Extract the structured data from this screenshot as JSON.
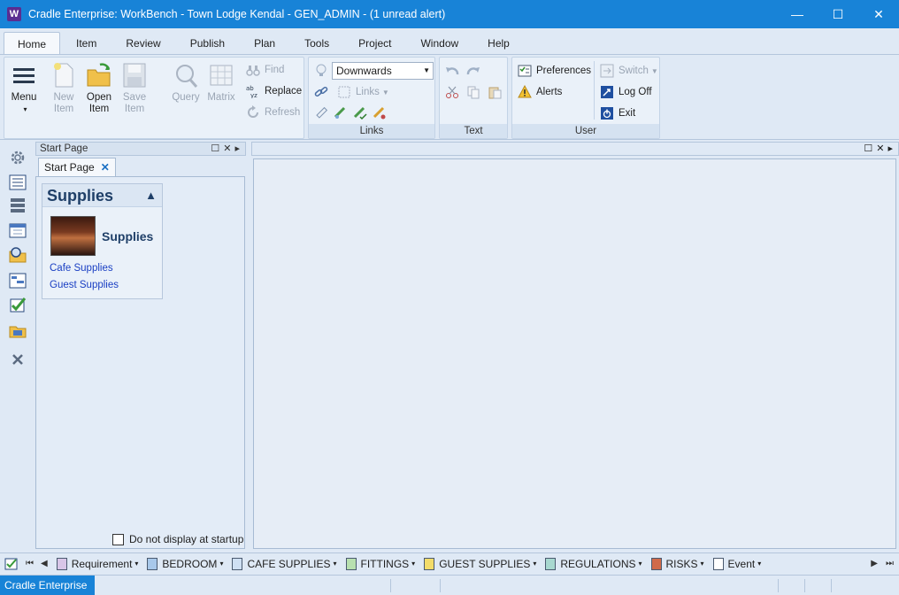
{
  "window": {
    "app_icon_letter": "W",
    "title": "Cradle Enterprise: WorkBench - Town Lodge Kendal - GEN_ADMIN - (1 unread alert)",
    "minimize": "—",
    "maximize": "☐",
    "close": "✕"
  },
  "ribbon_tabs": [
    "Home",
    "Item",
    "Review",
    "Publish",
    "Plan",
    "Tools",
    "Project",
    "Window",
    "Help"
  ],
  "ribbon": {
    "menu": {
      "label": "Menu",
      "caret": "▾"
    },
    "new_item": {
      "line1": "New",
      "line2": "Item"
    },
    "open_item": {
      "line1": "Open",
      "line2": "Item"
    },
    "save_item": {
      "line1": "Save",
      "line2": "Item"
    },
    "query": "Query",
    "matrix": "Matrix",
    "find": "Find",
    "replace": "Replace",
    "refresh": "Refresh",
    "links_group": {
      "direction_value": "Downwards",
      "links_label": "Links",
      "group_label": "Links"
    },
    "text_group": {
      "group_label": "Text"
    },
    "user_group": {
      "preferences": "Preferences",
      "alerts": "Alerts",
      "switch": "Switch",
      "log_off": "Log Off",
      "exit": "Exit",
      "group_label": "User"
    }
  },
  "start_panel": {
    "header": "Start Page",
    "tab_label": "Start Page",
    "tab_close": "✕",
    "card": {
      "header": "Supplies",
      "title": "Supplies",
      "links": [
        "Cafe Supplies",
        "Guest Supplies"
      ]
    },
    "startup_checkbox_label": "Do not display at startup"
  },
  "panel_controls": "☐✕▸",
  "bottom_toolbar": {
    "items": [
      "Requirement",
      "BEDROOM",
      "CAFE SUPPLIES",
      "FITTINGS",
      "GUEST SUPPLIES",
      "REGULATIONS",
      "RISKS",
      "Event"
    ],
    "caret": "▾"
  },
  "statusbar": {
    "app_name": "Cradle Enterprise"
  },
  "colors": {
    "titlebar": "#1883d7",
    "accent": "#1f3f68",
    "link": "#1a3fc3"
  }
}
